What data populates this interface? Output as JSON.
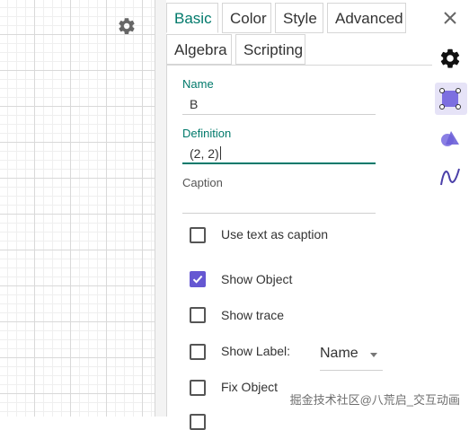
{
  "tabs": {
    "row1": [
      "Basic",
      "Color",
      "Style",
      "Advanced"
    ],
    "row2": [
      "Algebra",
      "Scripting"
    ],
    "active": "Basic"
  },
  "fields": {
    "name_label": "Name",
    "name_value": "B",
    "definition_label": "Definition",
    "definition_value": "(2, 2)",
    "caption_label": "Caption",
    "caption_value": ""
  },
  "checkboxes": [
    {
      "label": "Use text as caption",
      "checked": false
    },
    {
      "label": "Show Object",
      "checked": true
    },
    {
      "label": "Show trace",
      "checked": false
    },
    {
      "label": "Show Label:",
      "checked": false
    },
    {
      "label": "Fix Object",
      "checked": false
    }
  ],
  "label_select": {
    "selected": "Name"
  },
  "icons": {
    "graphics_settings": "gear-icon",
    "close": "close-icon",
    "sidebar": [
      "gear-icon",
      "point-style-icon",
      "shapes-icon",
      "curve-icon"
    ]
  },
  "colors": {
    "accent": "#00796b",
    "checkbox": "#6557d2",
    "sidebar_selected": "#e6e3f7"
  },
  "watermark": "掘金技术社区@八荒启_交互动画"
}
